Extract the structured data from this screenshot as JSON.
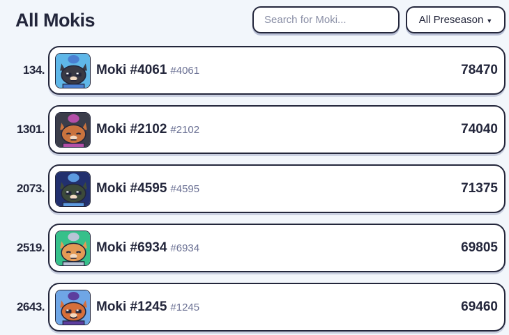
{
  "header": {
    "title": "All Mokis",
    "search_placeholder": "Search for Moki...",
    "season_filter": "All Preseason"
  },
  "mokis": [
    {
      "rank": "134.",
      "name": "Moki #4061",
      "id": "#4061",
      "score": "78470",
      "bg": "#5fb7e8",
      "fur": "#3a3a44",
      "accent": "#4a7fd1",
      "mood": "grumpy"
    },
    {
      "rank": "1301.",
      "name": "Moki #2102",
      "id": "#2102",
      "score": "74040",
      "bg": "#3b3d4a",
      "fur": "#c9733e",
      "accent": "#b44fa8",
      "mood": "sleepy"
    },
    {
      "rank": "2073.",
      "name": "Moki #4595",
      "id": "#4595",
      "score": "71375",
      "bg": "#22306e",
      "fur": "#3c4a3a",
      "accent": "#5d9be0",
      "mood": "grumpy"
    },
    {
      "rank": "2519.",
      "name": "Moki #6934",
      "id": "#6934",
      "score": "69805",
      "bg": "#36c08a",
      "fur": "#e39a55",
      "accent": "#b9c4d6",
      "mood": "sleepy"
    },
    {
      "rank": "2643.",
      "name": "Moki #1245",
      "id": "#1245",
      "score": "69460",
      "bg": "#6fa6e6",
      "fur": "#d66f3a",
      "accent": "#5c3e9e",
      "mood": "happy"
    }
  ]
}
